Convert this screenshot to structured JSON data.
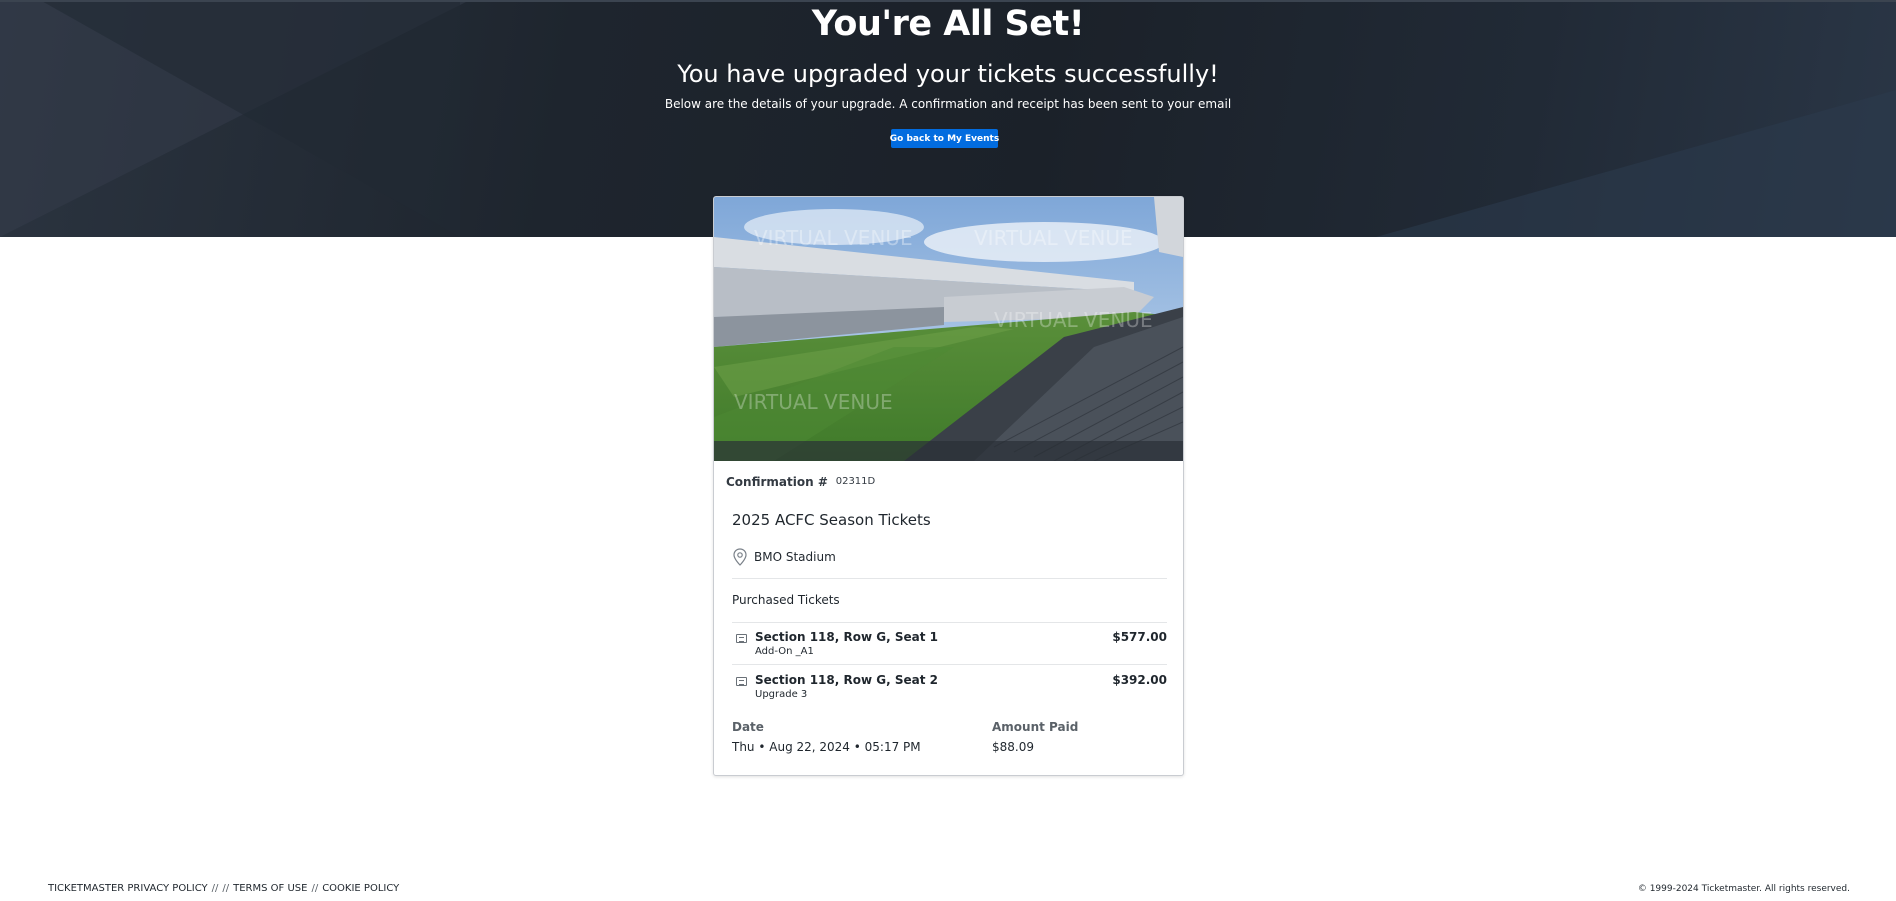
{
  "hero": {
    "title": "You're All Set!",
    "subtitle": "You have upgraded your tickets successfully!",
    "description": "Below are the details of your upgrade. A confirmation and receipt has been sent to your email",
    "button_label": "Go back to My Events"
  },
  "card": {
    "image_watermark": "VIRTUAL VENUE",
    "confirmation_label": "Confirmation #",
    "confirmation_number": "02311D",
    "event_title": "2025 ACFC Season Tickets",
    "venue_icon": "map-pin-icon",
    "venue": "BMO Stadium",
    "purchased_label": "Purchased Tickets",
    "tickets": [
      {
        "seat": "Section 118, Row G, Seat 1",
        "detail": "Add-On _A1",
        "price": "$577.00",
        "icon": "ticket-icon"
      },
      {
        "seat": "Section 118, Row G, Seat 2",
        "detail": "Upgrade 3",
        "price": "$392.00",
        "icon": "ticket-icon"
      }
    ],
    "date_label": "Date",
    "date_value": "Thu • Aug 22, 2024 • 05:17 PM",
    "amount_label": "Amount Paid",
    "amount_value": "$88.09"
  },
  "footer": {
    "privacy": "TICKETMASTER PRIVACY POLICY",
    "sep1": "//",
    "sep2": "//",
    "terms": "TERMS OF USE",
    "sep3": "//",
    "cookie": "COOKIE POLICY",
    "copyright": "© 1999-2024 Ticketmaster. All rights reserved."
  },
  "colors": {
    "accent": "#026cdf",
    "hero_bg": "#1e252e"
  }
}
